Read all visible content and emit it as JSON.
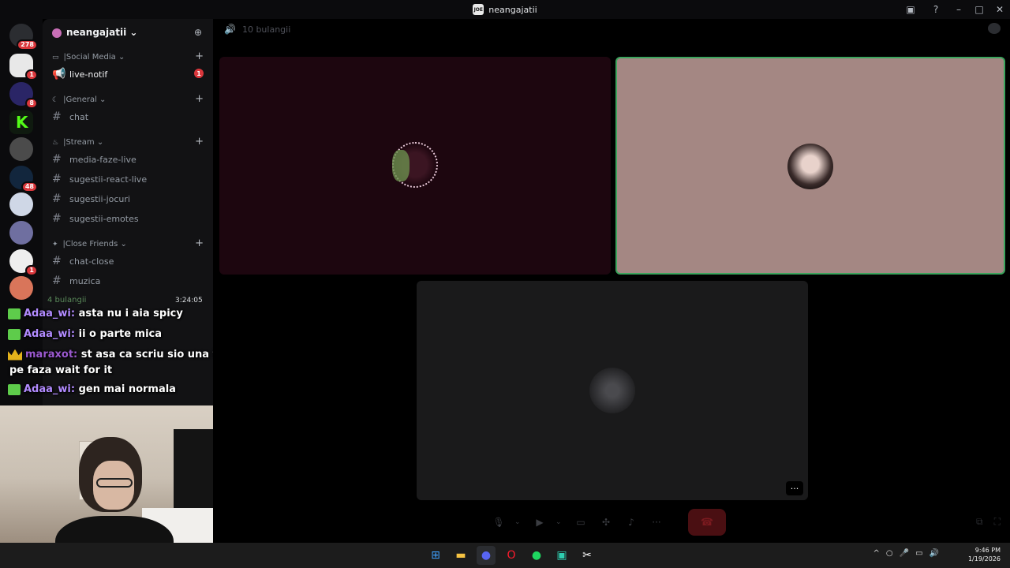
{
  "window": {
    "app_badge": "JOE",
    "title": "neangajatii"
  },
  "guild_badges": [
    "278",
    "1",
    "8",
    "48",
    "1"
  ],
  "server": {
    "name": "neangajatii"
  },
  "categories": [
    {
      "emoji": "▭",
      "label": "Social Media"
    },
    {
      "emoji": "☾",
      "label": "General"
    },
    {
      "emoji": "♨",
      "label": "Stream"
    },
    {
      "emoji": "✦",
      "label": "Close Friends"
    }
  ],
  "channels": [
    {
      "name": "live-notif",
      "badge": "1"
    },
    {
      "name": "chat"
    },
    {
      "name": "media-faze-live"
    },
    {
      "name": "sugestii-react-live"
    },
    {
      "name": "sugestii-jocuri"
    },
    {
      "name": "sugestii-emotes"
    },
    {
      "name": "chat-close"
    },
    {
      "name": "muzica"
    }
  ],
  "voice": {
    "header": "4 bulangii",
    "timer": "3:24:05",
    "channel_title": "10 bulangii"
  },
  "overlay_chat": [
    {
      "user": "Adaa_wi:",
      "message": "asta nu i aia spicy"
    },
    {
      "user": "Adaa_wi:",
      "message": "ii o parte mica"
    },
    {
      "user": "maraxot:",
      "message": "st asa ca scriu sio una fil"
    },
    {
      "user": "",
      "message": "pe faza wait for it"
    },
    {
      "user": "Adaa_wi:",
      "message": "gen mai normala"
    }
  ],
  "tile_more_label": "···",
  "taskbar": {
    "time": "9:46 PM",
    "date": "1/19/2026"
  },
  "colors": {
    "speaking_border": "#3ba55d",
    "badge_red": "#da373c",
    "sidebar_bg": "#121214",
    "chat_username": "#b28bff"
  }
}
